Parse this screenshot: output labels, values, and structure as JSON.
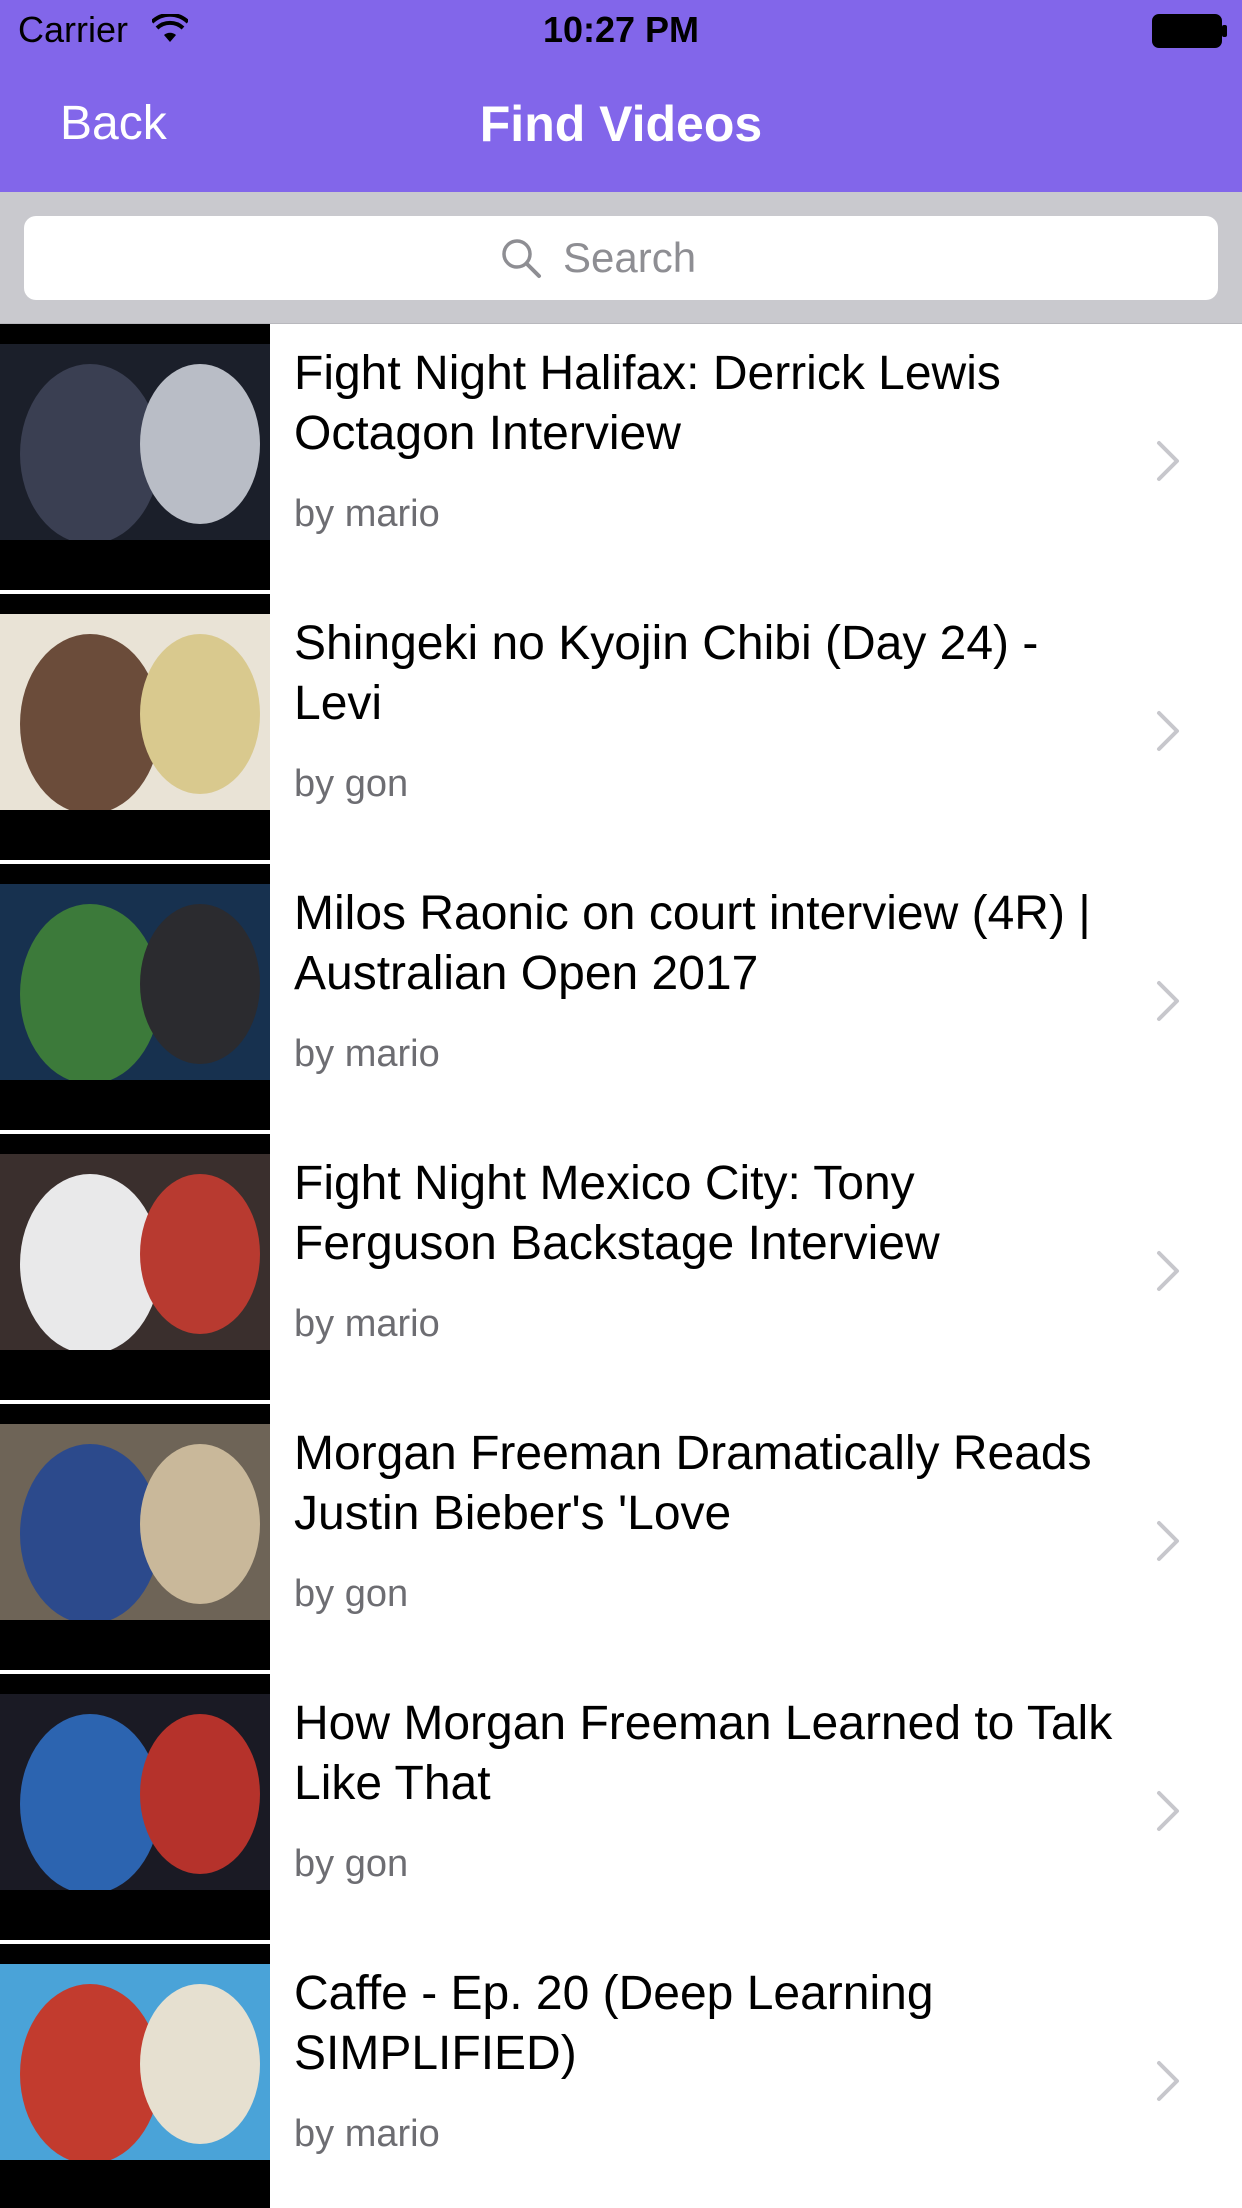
{
  "status_bar": {
    "carrier": "Carrier",
    "time": "10:27 PM"
  },
  "nav": {
    "back_label": "Back",
    "title": "Find Videos"
  },
  "search": {
    "placeholder": "Search"
  },
  "colors": {
    "nav_background": "#8266ea",
    "search_bar_background": "#c9c9ce",
    "subtitle_gray": "#6d6d72",
    "chevron_gray": "#c7c7cc"
  },
  "videos": [
    {
      "title": "Fight Night Halifax: Derrick Lewis Octagon Interview",
      "author": "by mario",
      "thumbnail_colors": [
        "#1b1f2a",
        "#3a3f52",
        "#b9bdc6"
      ]
    },
    {
      "title": "Shingeki no Kyojin Chibi (Day 24) - Levi",
      "author": "by gon",
      "thumbnail_colors": [
        "#e9e3d6",
        "#6b4c3a",
        "#d9c98e"
      ]
    },
    {
      "title": "Milos Raonic on court interview (4R) | Australian Open 2017",
      "author": "by mario",
      "thumbnail_colors": [
        "#17314f",
        "#3c7a3a",
        "#2b2b2f"
      ]
    },
    {
      "title": "Fight Night Mexico City: Tony Ferguson Backstage Interview",
      "author": "by mario",
      "thumbnail_colors": [
        "#3a2f2d",
        "#e9e9ea",
        "#b83a30"
      ]
    },
    {
      "title": "Morgan Freeman Dramatically Reads Justin Bieber's 'Love",
      "author": "by gon",
      "thumbnail_colors": [
        "#6e6457",
        "#2c4a8c",
        "#c9b89a"
      ]
    },
    {
      "title": "How Morgan Freeman Learned to Talk Like That",
      "author": "by gon",
      "thumbnail_colors": [
        "#1a1a24",
        "#2c64b0",
        "#b5322b"
      ]
    },
    {
      "title": "Caffe - Ep. 20 (Deep Learning SIMPLIFIED)",
      "author": "by mario",
      "thumbnail_colors": [
        "#4aa3d8",
        "#c23b2e",
        "#e6e0d0"
      ]
    }
  ]
}
